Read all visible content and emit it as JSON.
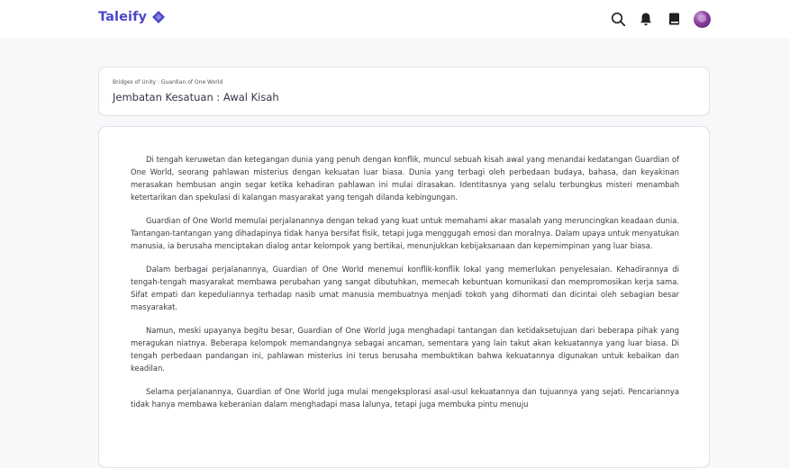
{
  "brand": {
    "name": "Taleify",
    "accent": "#4b47c9"
  },
  "header_icons": [
    "search-icon",
    "bell-icon",
    "book-icon",
    "avatar"
  ],
  "story": {
    "breadcrumb": "Bridges of Unity : Guardian of One World",
    "chapter_title": "Jembatan Kesatuan : Awal Kisah",
    "paragraphs": [
      "Di tengah keruwetan dan ketegangan dunia yang penuh dengan konflik, muncul sebuah kisah awal yang menandai kedatangan Guardian of One World, seorang pahlawan misterius dengan kekuatan luar biasa. Dunia yang terbagi oleh perbedaan budaya, bahasa, dan keyakinan merasakan hembusan angin segar ketika kehadiran pahlawan ini mulai dirasakan. Identitasnya yang selalu terbungkus misteri menambah ketertarikan dan spekulasi di kalangan masyarakat yang tengah dilanda kebingungan.",
      "Guardian of One World memulai perjalanannya dengan tekad yang kuat untuk memahami akar masalah yang meruncingkan keadaan dunia. Tantangan-tantangan yang dihadapinya tidak hanya bersifat fisik, tetapi juga menggugah emosi dan moralnya. Dalam upaya untuk menyatukan manusia, ia berusaha menciptakan dialog antar kelompok yang bertikai, menunjukkan kebijaksanaan dan kepemimpinan yang luar biasa.",
      "Dalam berbagai perjalanannya, Guardian of One World menemui konflik-konflik lokal yang memerlukan penyelesaian. Kehadirannya di tengah-tengah masyarakat membawa perubahan yang sangat dibutuhkan, memecah kebuntuan komunikasi dan mempromosikan kerja sama. Sifat empati dan kepeduliannya terhadap nasib umat manusia membuatnya menjadi tokoh yang dihormati dan dicintai oleh sebagian besar masyarakat.",
      "Namun, meski upayanya begitu besar, Guardian of One World juga menghadapi tantangan dan ketidaksetujuan dari beberapa pihak yang meragukan niatnya. Beberapa kelompok memandangnya sebagai ancaman, sementara yang lain takut akan kekuatannya yang luar biasa. Di tengah perbedaan pandangan ini, pahlawan misterius ini terus berusaha membuktikan bahwa kekuatannya digunakan untuk kebaikan dan keadilan.",
      "Selama perjalanannya, Guardian of One World juga mulai mengeksplorasi asal-usul kekuatannya dan tujuannya yang sejati. Pencariannya tidak hanya membawa keberanian dalam menghadapi masa lalunya, tetapi juga membuka pintu menuju"
    ]
  }
}
